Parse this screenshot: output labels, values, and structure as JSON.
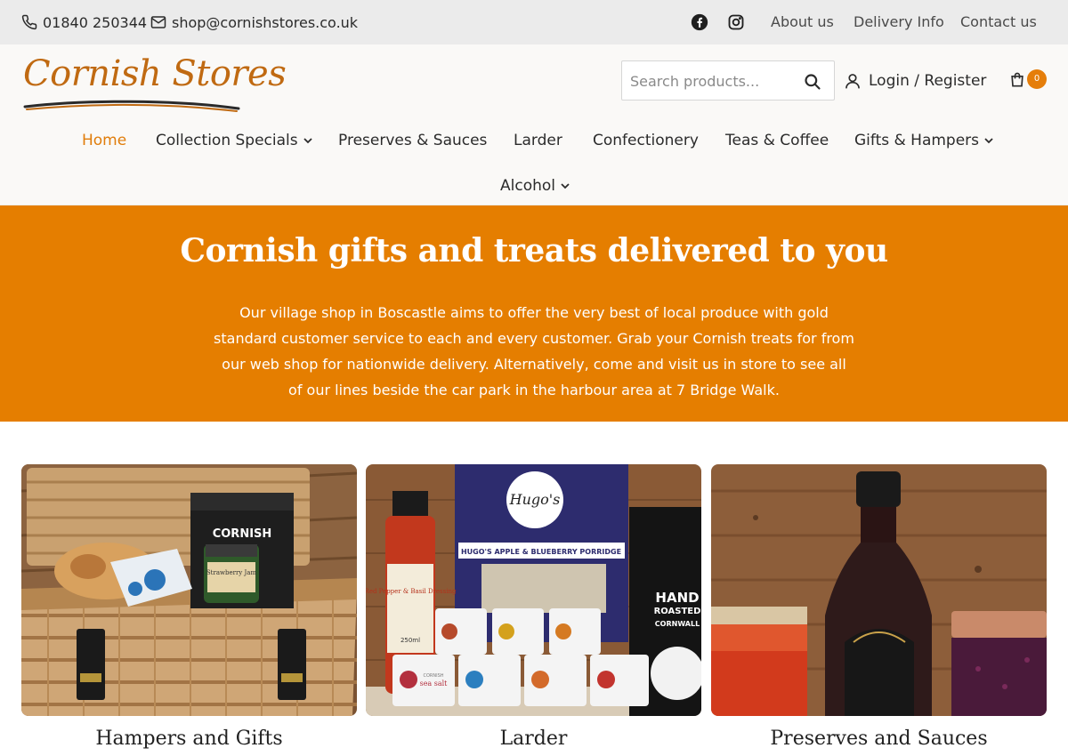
{
  "topbar": {
    "phone": "01840 250344",
    "email": "shop@cornishstores.co.uk",
    "social": [
      "facebook-icon",
      "instagram-icon"
    ],
    "links": [
      "About us",
      "Delivery Info",
      "Contact us"
    ]
  },
  "header": {
    "logo_text": "Cornish Stores",
    "search_placeholder": "Search products...",
    "login_label": "Login / Register",
    "cart_count": "0"
  },
  "nav": {
    "items": [
      {
        "label": "Home",
        "active": true
      },
      {
        "label": "Collection Specials",
        "dropdown": true
      },
      {
        "label": "Preserves & Sauces"
      },
      {
        "label": "Larder"
      },
      {
        "label": "Confectionery"
      },
      {
        "label": "Teas & Coffee"
      },
      {
        "label": "Gifts & Hampers",
        "dropdown": true
      },
      {
        "label": "Alcohol",
        "dropdown": true
      }
    ]
  },
  "hero": {
    "title": "Cornish gifts and treats delivered to you",
    "text": "Our village shop in Boscastle aims to offer the very best of local produce with gold standard customer service to each and every customer. Grab your Cornish treats for from our web shop for nationwide delivery. Alternatively, come and visit us in store to see all of our lines beside the car park in the harbour area at 7 Bridge Walk."
  },
  "categories": [
    {
      "title": "Hampers and Gifts",
      "image_text": {
        "box": "CORNISH",
        "jar": "Strawberry Jam"
      }
    },
    {
      "title": "Larder",
      "image_text": {
        "box_brand": "Hugo's",
        "box_label": "HUGO'S APPLE & BLUEBERRY PORRIDGE",
        "bottle": "Red Pepper & Basil Dressing",
        "bottle_volume": "250ml",
        "bag_1": "HAND",
        "bag_2": "ROASTED",
        "bag_3": "CORNWALL",
        "tub_line_1": "CORNISH",
        "tub_line_2": "sea salt"
      }
    },
    {
      "title": "Preserves and Sauces"
    }
  ],
  "colors": {
    "accent": "#e57e00",
    "nav_active": "#e07d0b",
    "topbar_bg": "#ebebeb",
    "logo": "#c06a12"
  }
}
